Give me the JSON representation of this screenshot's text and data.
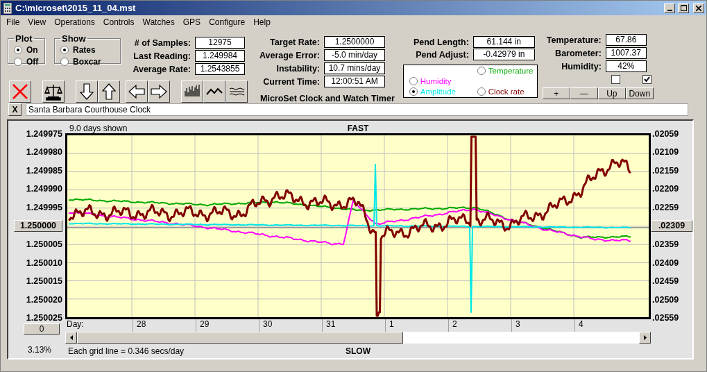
{
  "window": {
    "title": "C:\\microset\\2015_11_04.mst"
  },
  "menu": [
    "File",
    "View",
    "Operations",
    "Controls",
    "Watches",
    "GPS",
    "Configure",
    "Help"
  ],
  "plot_group": {
    "title": "Plot",
    "options": [
      {
        "label": "On",
        "selected": true
      },
      {
        "label": "Off",
        "selected": false
      }
    ]
  },
  "show_group": {
    "title": "Show",
    "options": [
      {
        "label": "Rates",
        "selected": true
      },
      {
        "label": "Boxcar",
        "selected": false
      }
    ]
  },
  "samples": [
    {
      "label": "# of Samples:",
      "value": "12975"
    },
    {
      "label": "Last Reading:",
      "value": "1.249984"
    },
    {
      "label": "Average Rate:",
      "value": "1.2543855"
    }
  ],
  "toolbar": [
    {
      "kind": "delete"
    },
    {
      "kind": "balance"
    },
    {
      "kind": "down"
    },
    {
      "kind": "up"
    },
    {
      "kind": "left"
    },
    {
      "kind": "right"
    },
    {
      "kind": "bars"
    },
    {
      "kind": "wave"
    },
    {
      "kind": "lines"
    }
  ],
  "rates": [
    {
      "label": "Target Rate:",
      "value": "1.2500000"
    },
    {
      "label": "Average Error:",
      "value": "-5.0 min/day"
    },
    {
      "label": "Instability:",
      "value": "10.7 mins/day"
    },
    {
      "label": "Current Time:",
      "value": "12:00:51 AM"
    }
  ],
  "app_title": "MicroSet Clock and Watch Timer",
  "pendulum": [
    {
      "label": "Pend Length:",
      "value": "61.144 in"
    },
    {
      "label": "Pend Adjust:",
      "value": "-0.42979 in"
    }
  ],
  "legend": [
    {
      "label": "Temperature",
      "color": "#00a800",
      "selected": false
    },
    {
      "label": "Humidity",
      "color": "#ff00ff",
      "selected": false
    },
    {
      "label": "Amplitude",
      "color": "#00e8e8",
      "selected": true
    },
    {
      "label": "Clock rate",
      "color": "#800000",
      "selected": false
    }
  ],
  "environment": [
    {
      "label": "Temperature:",
      "value": "67.86"
    },
    {
      "label": "Barometer:",
      "value": "1007.37"
    },
    {
      "label": "Humidity:",
      "value": "42%"
    }
  ],
  "checkboxes": [
    {
      "checked": false
    },
    {
      "checked": true
    }
  ],
  "adjust_buttons": [
    "+",
    "—",
    "Up",
    "Down"
  ],
  "name_field": {
    "clear": "X",
    "value": "Santa Barbara Courthouse Clock"
  },
  "chart": {
    "days_shown": "9.0 days shown",
    "top_label": "FAST",
    "bottom_label": "SLOW",
    "left_axis": [
      {
        "kind": "label",
        "text": "1.249975"
      },
      {
        "kind": "label",
        "text": "1.249980"
      },
      {
        "kind": "label",
        "text": "1.249985"
      },
      {
        "kind": "label",
        "text": "1.249990"
      },
      {
        "kind": "label",
        "text": "1.249995"
      },
      {
        "kind": "button",
        "text": "1.250000"
      },
      {
        "kind": "label",
        "text": "1.250005"
      },
      {
        "kind": "label",
        "text": "1.250010"
      },
      {
        "kind": "label",
        "text": "1.250015"
      },
      {
        "kind": "label",
        "text": "1.250020"
      },
      {
        "kind": "label",
        "text": "1.250025"
      }
    ],
    "right_axis": [
      {
        "kind": "label",
        "text": ".02059"
      },
      {
        "kind": "label",
        "text": ".02109"
      },
      {
        "kind": "label",
        "text": ".02159"
      },
      {
        "kind": "label",
        "text": ".02209"
      },
      {
        "kind": "label",
        "text": ".02259"
      },
      {
        "kind": "button",
        "text": ".02309"
      },
      {
        "kind": "label",
        "text": ".02359"
      },
      {
        "kind": "label",
        "text": ".02409"
      },
      {
        "kind": "label",
        "text": ".02459"
      },
      {
        "kind": "label",
        "text": ".02509"
      },
      {
        "kind": "label",
        "text": ".02559"
      }
    ],
    "zero_button": "0",
    "day_label": "Day:",
    "days": [
      "28",
      "29",
      "30",
      "31",
      "1",
      "2",
      "3",
      "4"
    ],
    "percent": "3.13%",
    "grid_note": "Each grid line = 0.346 secs/day"
  }
}
